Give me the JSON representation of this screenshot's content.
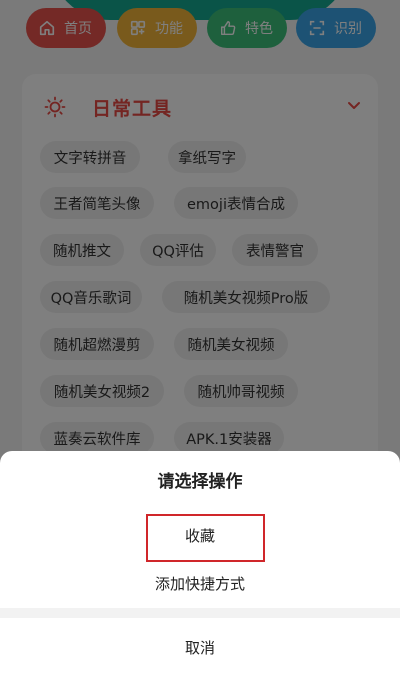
{
  "nav": {
    "items": [
      {
        "label": "首页",
        "icon": "home-icon",
        "color": "#e8534d"
      },
      {
        "label": "功能",
        "icon": "grid-icon",
        "color": "#f2b538"
      },
      {
        "label": "特色",
        "icon": "thumb-up-icon",
        "color": "#3cc17a"
      },
      {
        "label": "识别",
        "icon": "scan-icon",
        "color": "#3aa5e8"
      }
    ]
  },
  "card": {
    "title": "日常工具",
    "title_color": "#e84b45",
    "tags": [
      "文字转拼音",
      "拿纸写字",
      "王者简笔头像",
      "emoji表情合成",
      "随机推文",
      "QQ评估",
      "表情警官",
      "QQ音乐歌词",
      "随机美女视频Pro版",
      "随机超燃漫剪",
      "随机美女视频",
      "随机美女视频2",
      "随机帅哥视频",
      "蓝奏云软件库",
      "APK.1安装器"
    ]
  },
  "sheet": {
    "title": "请选择操作",
    "options": [
      "收藏",
      "添加快捷方式"
    ],
    "highlight_color": "#d0262a",
    "cancel": "取消"
  }
}
